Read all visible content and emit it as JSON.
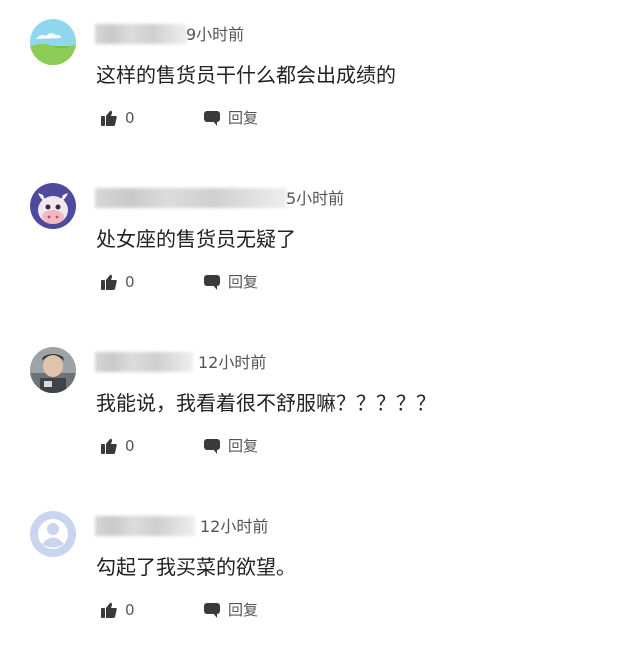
{
  "comments": [
    {
      "time": "9小时前",
      "text": "这样的售货员干什么都会出成绩的",
      "likes": "0",
      "reply_label": "回复",
      "avatar_icon": "landscape-avatar-icon"
    },
    {
      "time": "5小时前",
      "text": "处女座的售货员无疑了",
      "likes": "0",
      "reply_label": "回复",
      "avatar_icon": "cartoon-cow-avatar-icon"
    },
    {
      "time": "12小时前",
      "text": "我能说，我看着很不舒服嘛？？？？？",
      "likes": "0",
      "reply_label": "回复",
      "avatar_icon": "photo-avatar-icon"
    },
    {
      "time": "12小时前",
      "text": "勾起了我买菜的欲望。",
      "likes": "0",
      "reply_label": "回复",
      "avatar_icon": "default-user-avatar-icon"
    }
  ],
  "colors": {
    "text": "#222222",
    "meta": "#555555",
    "icon": "#3a3a3a",
    "default_avatar": "#c9d5ee"
  }
}
